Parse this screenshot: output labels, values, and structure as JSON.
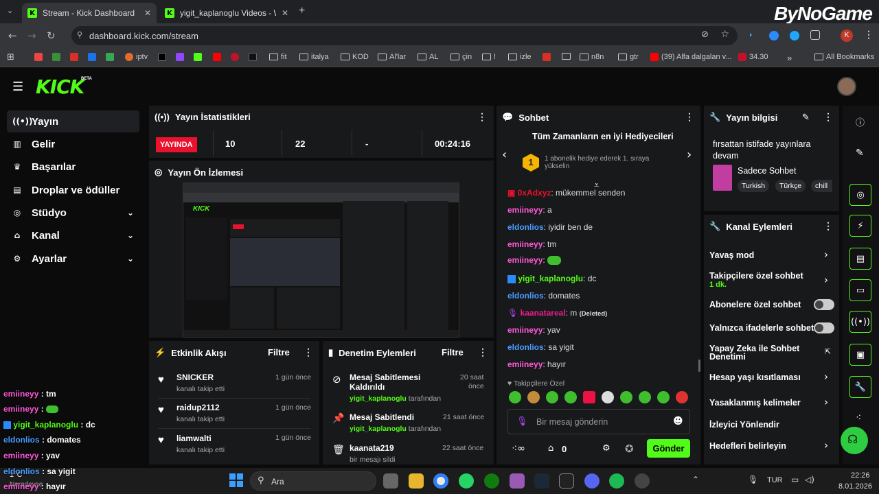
{
  "browser": {
    "tabs": [
      {
        "title": "Stream - Kick Dashboard"
      },
      {
        "title": "yigit_kaplanoglu Videos - Watc"
      }
    ],
    "url": "dashboard.kick.com/stream",
    "bookmarks": [
      "iptv",
      "fit",
      "italya",
      "KOD",
      "Al'lar",
      "AL",
      "çin",
      "!",
      "izle",
      "n8n",
      "gtr",
      "(39) Alfa dalgalan v...",
      "34.30"
    ],
    "all_bookmarks": "All Bookmarks",
    "watermark": "ByNoGame"
  },
  "kick": {
    "logo": "KICK",
    "beta": "BETA"
  },
  "sidebar": {
    "items": [
      {
        "label": "Yayın",
        "icon": "broadcast-icon"
      },
      {
        "label": "Gelir",
        "icon": "revenue-icon"
      },
      {
        "label": "Başarılar",
        "icon": "trophy-icon"
      },
      {
        "label": "Droplar ve ödüller",
        "icon": "gift-icon"
      },
      {
        "label": "Stüdyo",
        "icon": "studio-icon"
      },
      {
        "label": "Kanal",
        "icon": "channel-icon"
      },
      {
        "label": "Ayarlar",
        "icon": "gear-icon"
      }
    ]
  },
  "stats": {
    "title": "Yayın İstatistikleri",
    "live_badge": "YAYINDA",
    "viewers": "10",
    "followers": "22",
    "dash": "-",
    "duration": "00:24:16"
  },
  "preview": {
    "title": "Yayın Ön İzlemesi"
  },
  "activity": {
    "title": "Etkinlik Akışı",
    "filter": "Filtre",
    "items": [
      {
        "name": "SNICKER",
        "sub": "kanalı takip etti",
        "time": "1 gün önce"
      },
      {
        "name": "raidup2112",
        "sub": "kanalı takip etti",
        "time": "1 gün önce"
      },
      {
        "name": "liamwalti",
        "sub": "kanalı takip etti",
        "time": "1 gün önce"
      }
    ]
  },
  "moderation": {
    "title": "Denetim Eylemleri",
    "filter": "Filtre",
    "items": [
      {
        "line1": "Mesaj Sabitlemesi",
        "line2": "Kaldırıldı",
        "user": "yigit_kaplanoglu",
        "by": "tarafından",
        "time1": "20 saat",
        "time2": "önce"
      },
      {
        "line1": "Mesaj Sabitlendi",
        "user": "yigit_kaplanoglu",
        "by": "tarafından",
        "time1": "21 saat önce"
      },
      {
        "line1": "kaanata219",
        "user": "bir mesajı sildi",
        "time1": "22 saat önce"
      }
    ]
  },
  "chat": {
    "title": "Sohbet",
    "gifters_title": "Tüm Zamanların en iyi Hediyecileri",
    "gift_rank": "1",
    "gift_text": "1 abonelik hediye ederek 1. sıraya yükselin",
    "messages": [
      {
        "user": "0xAdxyz",
        "text": ": mükemmel senden",
        "color": "#e9112b"
      },
      {
        "user": "emiineyy",
        "text": ": a",
        "color": "#ff5ad9"
      },
      {
        "user": "eldonlios",
        "text": ": iyidir ben de",
        "color": "#4a9bff"
      },
      {
        "user": "emiineyy",
        "text": ": tm",
        "color": "#ff5ad9"
      },
      {
        "user": "emiineyy",
        "text": ":",
        "color": "#ff5ad9"
      },
      {
        "user": "yigit_kaplanoglu",
        "text": ": dc",
        "color": "#53fc18"
      },
      {
        "user": "eldonlios",
        "text": ": domates",
        "color": "#4a9bff"
      },
      {
        "user": "kaanatareal",
        "text": ": m",
        "deleted": "(Deleted)",
        "color": "#e91e8c"
      },
      {
        "user": "emiineyy",
        "text": ": yav",
        "color": "#ff5ad9"
      },
      {
        "user": "eldonlios",
        "text": ": sa yigit",
        "color": "#4a9bff"
      },
      {
        "user": "emiineyy",
        "text": ": hayır",
        "color": "#ff5ad9"
      }
    ],
    "followers_only": "Takipçilere Özel",
    "placeholder": "Bir mesaj gönderin",
    "count": "0",
    "send": "Gönder"
  },
  "info": {
    "title": "Yayın bilgisi",
    "stream_title": "fırsattan istifade yayınlara devam",
    "category": "Sadece Sohbet",
    "tags": [
      "Turkish",
      "Türkçe",
      "chill"
    ]
  },
  "channel_actions": {
    "title": "Kanal Eylemleri",
    "items": [
      {
        "label": "Yavaş mod",
        "type": "arrow"
      },
      {
        "label": "Takipçilere özel sohbet",
        "sub": "1 dk.",
        "type": "arrow"
      },
      {
        "label": "Abonelere özel sohbet",
        "type": "toggle"
      },
      {
        "label": "Yalnızca ifadelerle sohbet",
        "type": "toggle"
      },
      {
        "label": "Yapay Zeka ile Sohbet",
        "label2": "Denetimi",
        "type": "external"
      },
      {
        "label": "Hesap yaşı kısıtlaması",
        "type": "arrow"
      },
      {
        "label": "Yasaklanmış kelimeler",
        "type": "arrow"
      },
      {
        "label": "İzleyici Yönlendir",
        "type": "none"
      },
      {
        "label": "Hedefleri belirleyin",
        "type": "arrow"
      }
    ]
  },
  "overlay_chat": [
    {
      "user": "emiineyy",
      "text": " : tm",
      "color": "#ff5ad9"
    },
    {
      "user": "emiineyy",
      "text": " :",
      "color": "#ff5ad9"
    },
    {
      "user": "yigit_kaplanoglu",
      "text": " : dc",
      "color": "#53fc18"
    },
    {
      "user": "eldonlios",
      "text": " : domates",
      "color": "#4a9bff"
    },
    {
      "user": "emiineyy",
      "text": " : yav",
      "color": "#ff5ad9"
    },
    {
      "user": "eldonlios",
      "text": " : sa yigit",
      "color": "#4a9bff"
    },
    {
      "user": "emiineyy",
      "text": " : hayır",
      "color": "#ff5ad9"
    }
  ],
  "taskbar": {
    "search": "Ara",
    "weather": "1°C",
    "weather_sub": "Neredeyse",
    "lang": "TUR",
    "time": "22:26",
    "date": "8.01.2026"
  }
}
